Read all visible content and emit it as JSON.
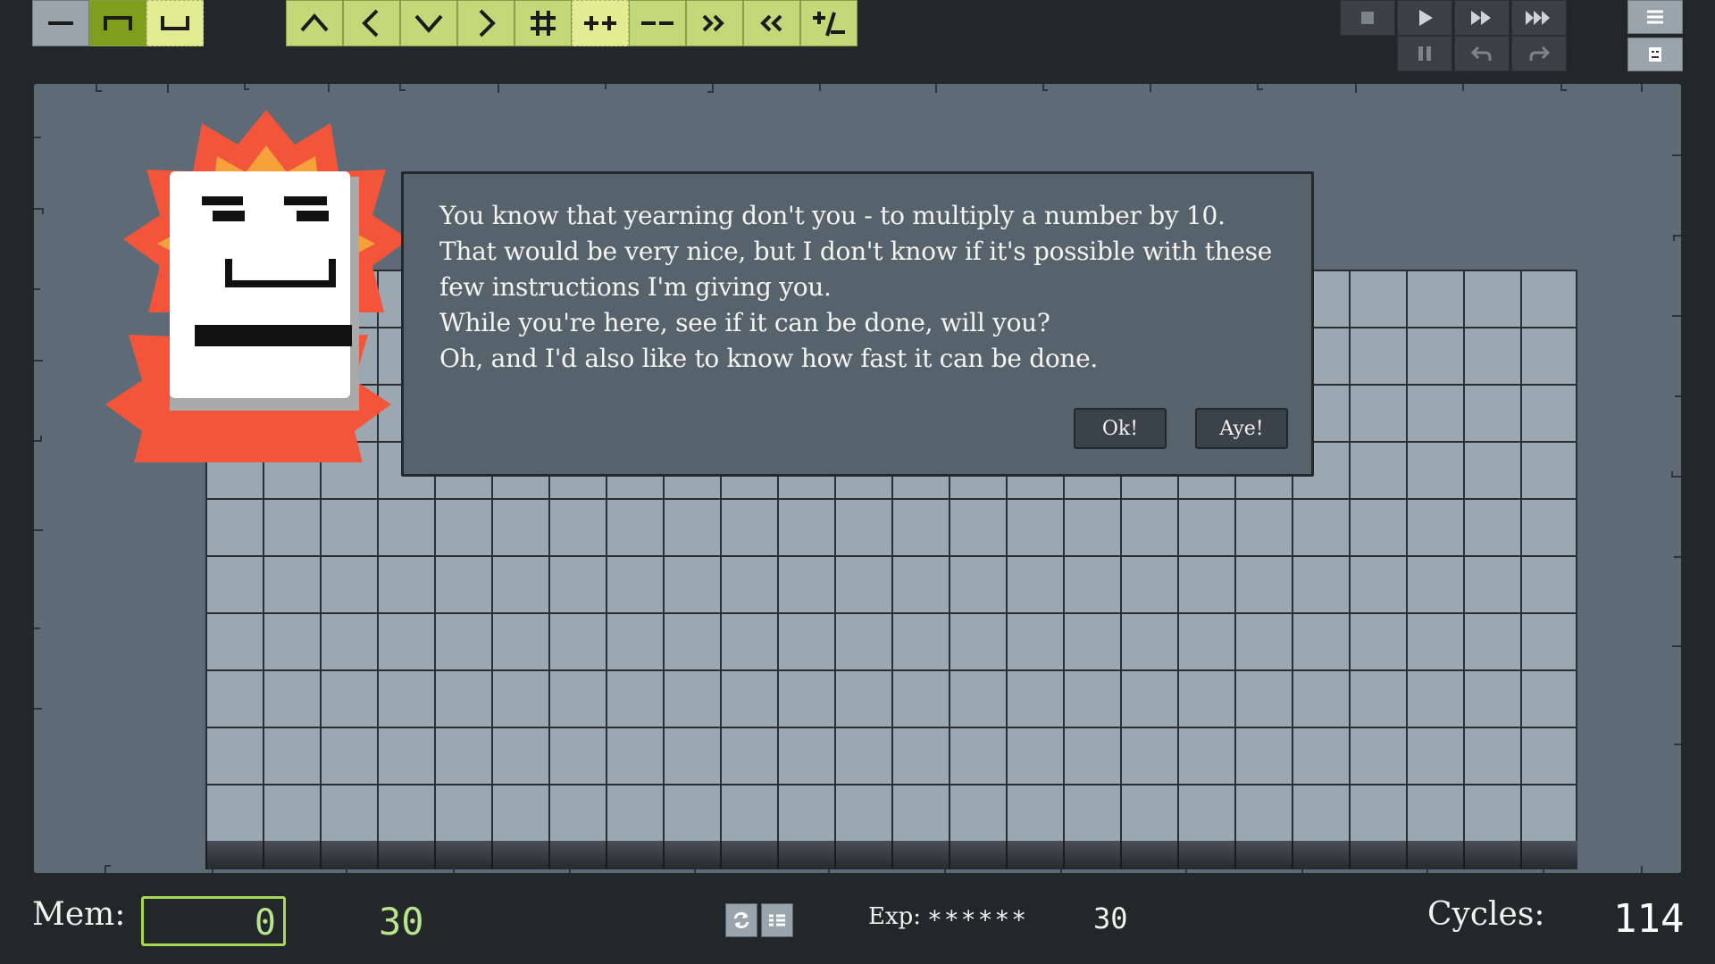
{
  "toolbar": {
    "left_group": [
      {
        "icon": "dash-icon",
        "state": "normal"
      },
      {
        "icon": "bracket-top-icon",
        "state": "selected"
      },
      {
        "icon": "bracket-bottom-icon",
        "state": "light"
      }
    ],
    "instructions": [
      {
        "icon": "up-arrow-icon"
      },
      {
        "icon": "left-arrow-icon"
      },
      {
        "icon": "down-arrow-icon"
      },
      {
        "icon": "right-arrow-icon"
      },
      {
        "icon": "hash-icon"
      },
      {
        "icon": "increment-icon",
        "text": "++"
      },
      {
        "icon": "decrement-icon",
        "text": "--"
      },
      {
        "icon": "double-right-icon",
        "text": "»"
      },
      {
        "icon": "double-left-icon",
        "text": "«"
      },
      {
        "icon": "plus-minus-icon"
      }
    ],
    "controls": [
      "stop-icon",
      "play-icon",
      "fast-forward-icon",
      "fastest-forward-icon",
      "pause-icon",
      "undo-icon",
      "redo-icon"
    ],
    "menu": [
      "hamburger-menu-icon",
      "robot-icon"
    ]
  },
  "dialog": {
    "lines": [
      "You know that yearning don't you - to multiply a number by 10.",
      "That would be very nice, but I don't know if it's possible with these",
      "few instructions I'm giving you.",
      "While you're here, see if it can be done, will you?",
      "Oh, and I'd also like to know how fast it can be done."
    ],
    "ok_label": "Ok!",
    "aye_label": "Aye!"
  },
  "footer": {
    "mem_label": "Mem:",
    "mem_value": "0",
    "mem_count": "30",
    "exp_label": "Exp:",
    "exp_stars": "******",
    "exp_value": "30",
    "cycles_label": "Cycles:",
    "cycles_value": "114"
  },
  "colors": {
    "toolbar_green": "#c4d87a",
    "toolbar_selected": "#7f9e1b",
    "board": "#5e6a76",
    "grid_cell": "#9ba8b1",
    "dialog_bg": "#56626c",
    "mem_value_color": "#b7e48d",
    "burst_outer": "#f2553a",
    "burst_inner": "#f6a23a"
  }
}
